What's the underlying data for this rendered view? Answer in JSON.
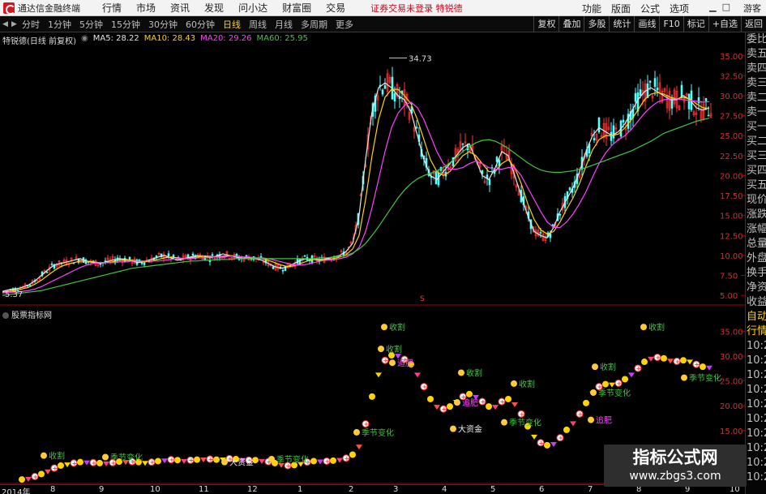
{
  "window": {
    "title": "通达信金融终端",
    "menu": [
      "行情",
      "市场",
      "资讯",
      "发现",
      "问小达",
      "财富圈",
      "交易"
    ],
    "notice": "证券交易未登录  特锐德",
    "right_menu": [
      "功能",
      "版面",
      "公式",
      "选项"
    ],
    "guest": "游客"
  },
  "toolbar": {
    "periods": [
      "分时",
      "1分钟",
      "5分钟",
      "15分钟",
      "30分钟",
      "60分钟",
      "日线",
      "周线",
      "月线",
      "多周期",
      "更多"
    ],
    "active_period": "日线",
    "right_buttons": [
      "复权",
      "叠加",
      "多股",
      "统计",
      "画线",
      "F10",
      "标记",
      "+自选",
      "返回"
    ]
  },
  "upper": {
    "stock": "特锐德(日线 前复权)",
    "ma": [
      {
        "label": "MA5: 28.22",
        "color": "#e6e6e6"
      },
      {
        "label": "MA10: 28.43",
        "color": "#ffd400"
      },
      {
        "label": "MA20: 29.26",
        "color": "#ff40ff"
      },
      {
        "label": "MA60: 25.95",
        "color": "#3cc83c"
      }
    ],
    "y_ticks": [
      "35.00",
      "32.50",
      "30.00",
      "27.50",
      "25.00",
      "22.50",
      "20.00",
      "17.50",
      "15.00",
      "12.50",
      "10.00",
      "7.50",
      "5.00"
    ],
    "high_label": "34.73",
    "low_label": "5.37"
  },
  "lower": {
    "title": "股票指标网",
    "y_ticks": [
      "35.00",
      "30.00",
      "25.00",
      "20.00",
      "15.00",
      "10.00"
    ],
    "tags": {
      "harvest": "收割",
      "fatten": "追肥",
      "season": "季节变化",
      "funds": "大资金"
    }
  },
  "date_axis": [
    "2014年",
    "8",
    "9",
    "10",
    "11",
    "12",
    "1",
    "2",
    "3",
    "4",
    "5",
    "6",
    "7",
    "8",
    "9",
    "10"
  ],
  "side_panel": [
    "委比",
    "卖五",
    "卖四",
    "卖三",
    "卖二",
    "卖一",
    "买一",
    "买二",
    "买三",
    "买四",
    "买五",
    "现价",
    "涨跌",
    "涨幅",
    "总量",
    "外盘",
    "换手",
    "净资",
    "收益",
    "自动",
    "行情",
    "10:2",
    "10:2",
    "10:2",
    "10:2",
    "10:2",
    "10:2",
    "10:2",
    "10:2",
    "10:2",
    "10:2"
  ],
  "watermark": {
    "title": "指标公式网",
    "url": "www.zbgs3.com"
  },
  "chart_data": {
    "type": "line",
    "title": "特锐德(日线 前复权)",
    "ylim": [
      4,
      36.5
    ],
    "x": [
      0,
      8,
      16,
      24,
      32,
      40,
      48,
      56,
      64,
      72,
      80,
      88,
      96,
      104,
      112,
      120,
      128,
      136,
      144,
      152,
      160,
      168,
      176,
      184,
      192,
      200,
      208,
      216,
      224,
      232,
      240,
      248,
      256,
      264,
      272,
      280,
      288,
      296,
      304,
      312,
      320,
      328,
      336,
      344,
      352,
      360,
      368,
      376,
      384,
      392,
      400,
      408,
      416,
      424,
      432,
      440,
      448,
      456,
      464,
      472,
      480,
      488,
      496,
      504,
      512,
      520,
      528,
      536,
      544,
      552,
      560,
      568,
      576,
      584,
      592,
      600,
      608,
      616,
      624,
      632,
      640,
      648,
      656,
      664,
      672,
      680,
      688,
      696,
      704,
      712,
      720,
      728,
      736,
      744,
      752,
      760,
      768,
      776,
      784,
      792,
      800,
      808,
      816,
      824,
      832,
      840,
      848,
      856,
      864,
      872
    ],
    "series": [
      {
        "name": "MA5",
        "color": "#e6e6e6",
        "values": [
          5.5,
          5.7,
          5.8,
          6.0,
          6.3,
          6.8,
          7.5,
          8.2,
          8.8,
          9.0,
          9.2,
          9.4,
          9.6,
          9.3,
          9.1,
          9.0,
          9.2,
          9.4,
          9.6,
          9.5,
          9.3,
          9.1,
          9.3,
          9.5,
          9.8,
          10.0,
          9.7,
          9.4,
          9.6,
          9.8,
          10.0,
          9.9,
          9.7,
          9.9,
          10.2,
          10.0,
          9.8,
          9.6,
          9.8,
          9.6,
          9.4,
          9.0,
          8.6,
          8.4,
          8.6,
          9.0,
          9.4,
          9.6,
          9.5,
          9.4,
          9.6,
          9.8,
          10.0,
          10.5,
          11.5,
          15.0,
          22.0,
          28.0,
          31.0,
          31.6,
          31.0,
          30.0,
          29.5,
          28.0,
          25.0,
          22.0,
          20.0,
          19.5,
          20.5,
          21.5,
          22.5,
          23.5,
          24.0,
          22.0,
          20.0,
          19.5,
          21.0,
          23.0,
          22.5,
          20.0,
          17.5,
          15.0,
          13.0,
          12.5,
          12.2,
          13.5,
          15.5,
          17.0,
          18.5,
          20.5,
          23.0,
          25.0,
          26.0,
          25.5,
          25.0,
          25.5,
          26.5,
          28.0,
          29.5,
          30.5,
          31.0,
          30.5,
          30.0,
          29.5,
          29.5,
          30.0,
          29.5,
          28.5,
          28.2,
          28.5
        ]
      },
      {
        "name": "MA10",
        "color": "#ffd400",
        "values": [
          5.4,
          5.5,
          5.6,
          5.8,
          6.0,
          6.4,
          6.9,
          7.5,
          8.1,
          8.6,
          8.9,
          9.1,
          9.3,
          9.3,
          9.2,
          9.1,
          9.1,
          9.2,
          9.4,
          9.4,
          9.4,
          9.3,
          9.2,
          9.3,
          9.5,
          9.7,
          9.8,
          9.7,
          9.6,
          9.7,
          9.8,
          9.9,
          9.9,
          9.8,
          9.9,
          10.0,
          9.9,
          9.8,
          9.7,
          9.7,
          9.6,
          9.4,
          9.1,
          8.8,
          8.6,
          8.7,
          9.0,
          9.3,
          9.5,
          9.5,
          9.5,
          9.6,
          9.8,
          10.1,
          10.8,
          12.5,
          17.0,
          22.5,
          27.0,
          29.8,
          30.8,
          30.8,
          30.0,
          29.0,
          27.0,
          24.5,
          22.0,
          20.5,
          20.0,
          20.5,
          21.5,
          22.5,
          23.0,
          22.5,
          21.5,
          20.5,
          20.5,
          21.5,
          22.0,
          21.0,
          19.0,
          16.5,
          14.5,
          13.2,
          12.7,
          13.0,
          14.2,
          15.8,
          17.2,
          19.0,
          21.2,
          23.2,
          24.5,
          25.0,
          25.0,
          25.2,
          26.0,
          27.0,
          28.2,
          29.5,
          30.2,
          30.4,
          30.2,
          29.8,
          29.6,
          29.8,
          29.6,
          29.0,
          28.5,
          28.4
        ]
      },
      {
        "name": "MA20",
        "color": "#ff40ff",
        "values": [
          5.3,
          5.4,
          5.4,
          5.5,
          5.6,
          5.8,
          6.1,
          6.5,
          6.9,
          7.3,
          7.7,
          8.1,
          8.5,
          8.8,
          9.0,
          9.1,
          9.1,
          9.1,
          9.2,
          9.2,
          9.3,
          9.3,
          9.3,
          9.3,
          9.3,
          9.4,
          9.5,
          9.6,
          9.6,
          9.6,
          9.7,
          9.7,
          9.8,
          9.8,
          9.8,
          9.9,
          9.9,
          9.8,
          9.8,
          9.7,
          9.7,
          9.6,
          9.4,
          9.2,
          9.0,
          8.8,
          8.8,
          8.9,
          9.1,
          9.3,
          9.4,
          9.5,
          9.6,
          9.8,
          10.2,
          11.0,
          13.0,
          16.0,
          19.5,
          23.0,
          26.0,
          27.8,
          28.8,
          29.2,
          28.5,
          27.0,
          25.0,
          23.0,
          21.5,
          20.8,
          20.8,
          21.0,
          21.5,
          21.8,
          21.5,
          21.0,
          20.8,
          20.8,
          21.0,
          21.0,
          20.0,
          18.5,
          17.0,
          15.5,
          14.2,
          13.5,
          13.5,
          14.2,
          15.2,
          16.5,
          18.0,
          19.8,
          21.5,
          22.8,
          23.8,
          24.5,
          25.0,
          25.8,
          26.8,
          27.8,
          28.6,
          29.2,
          29.5,
          29.6,
          29.6,
          29.5,
          29.4,
          29.3,
          29.2,
          29.26
        ]
      },
      {
        "name": "MA60",
        "color": "#3cc83c",
        "values": [
          5.0,
          5.1,
          5.2,
          5.3,
          5.4,
          5.5,
          5.6,
          5.8,
          6.0,
          6.2,
          6.4,
          6.6,
          6.8,
          7.0,
          7.2,
          7.4,
          7.6,
          7.8,
          8.0,
          8.2,
          8.4,
          8.5,
          8.6,
          8.7,
          8.8,
          8.9,
          9.0,
          9.1,
          9.2,
          9.3,
          9.3,
          9.4,
          9.4,
          9.5,
          9.5,
          9.5,
          9.6,
          9.6,
          9.6,
          9.6,
          9.6,
          9.6,
          9.6,
          9.6,
          9.6,
          9.6,
          9.6,
          9.6,
          9.6,
          9.7,
          9.7,
          9.8,
          9.9,
          10.0,
          10.3,
          10.8,
          11.5,
          12.5,
          13.6,
          14.8,
          16.0,
          17.2,
          18.2,
          19.0,
          19.6,
          20.0,
          20.3,
          20.6,
          21.0,
          21.6,
          22.3,
          23.0,
          23.6,
          24.1,
          24.4,
          24.5,
          24.3,
          23.9,
          23.4,
          22.8,
          22.2,
          21.6,
          21.1,
          20.7,
          20.5,
          20.4,
          20.4,
          20.5,
          20.6,
          20.8,
          21.0,
          21.3,
          21.6,
          21.9,
          22.2,
          22.5,
          22.8,
          23.1,
          23.5,
          23.9,
          24.3,
          24.8,
          25.3,
          25.6,
          25.9,
          26.2,
          26.5,
          26.8,
          27.0,
          27.2
        ]
      }
    ]
  }
}
